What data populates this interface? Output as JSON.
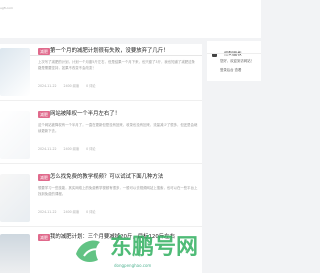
{
  "site": {
    "url_fragment": "ugfi.com"
  },
  "articles": [
    {
      "tag": "减肥",
      "title": "第一个月的减肥计划很有失败，没要放弃了几斤！",
      "excerpt": "上次写了减肥的计划，计划一个月瘦5斤左右，但是结果一个月下来，也只瘦了3斤，我也知道了减肥这条路是需要坚持，如果不改变不会改变！",
      "date": "2024-11-22",
      "views": "2400 阅读",
      "comments": "0 评论"
    },
    {
      "tag": "减肥",
      "title": "网站被降权一个半月左右了！",
      "excerpt": "这个网站被降权有一个半月了，一直在更新但是没有回来，收录也没有回来，流量减少了很多，但还是会继续更新下去。",
      "date": "2024-11-22",
      "views": "2400 阅读",
      "comments": "0 评论"
    },
    {
      "tag": "减肥",
      "title": "怎么找免费的教学视频？可以试试下面几种方法",
      "excerpt": "想要学习一些技能，其实网络上的免费教学视频有很多，一般可以去视频网站上搜索，也可以在一些平台上找到免费的课程。",
      "date": "2024-11-22",
      "views": "2400 阅读",
      "comments": "0 评论"
    },
    {
      "tag": "减肥",
      "title": "我的减肥计划：三个月要减掉20斤，目标120斤左右",
      "excerpt": "",
      "date": "",
      "views": "",
      "comments": ""
    }
  ],
  "panel": {
    "title": "控制面板",
    "lines": [
      "您好，欢迎到访网站！",
      "登录后台 查看"
    ]
  },
  "watermark": {
    "text": "东鹏号网",
    "sub": "dongpenghao.com"
  },
  "colors": {
    "tag": "#e06a8c",
    "watermark": "#30af5f"
  }
}
